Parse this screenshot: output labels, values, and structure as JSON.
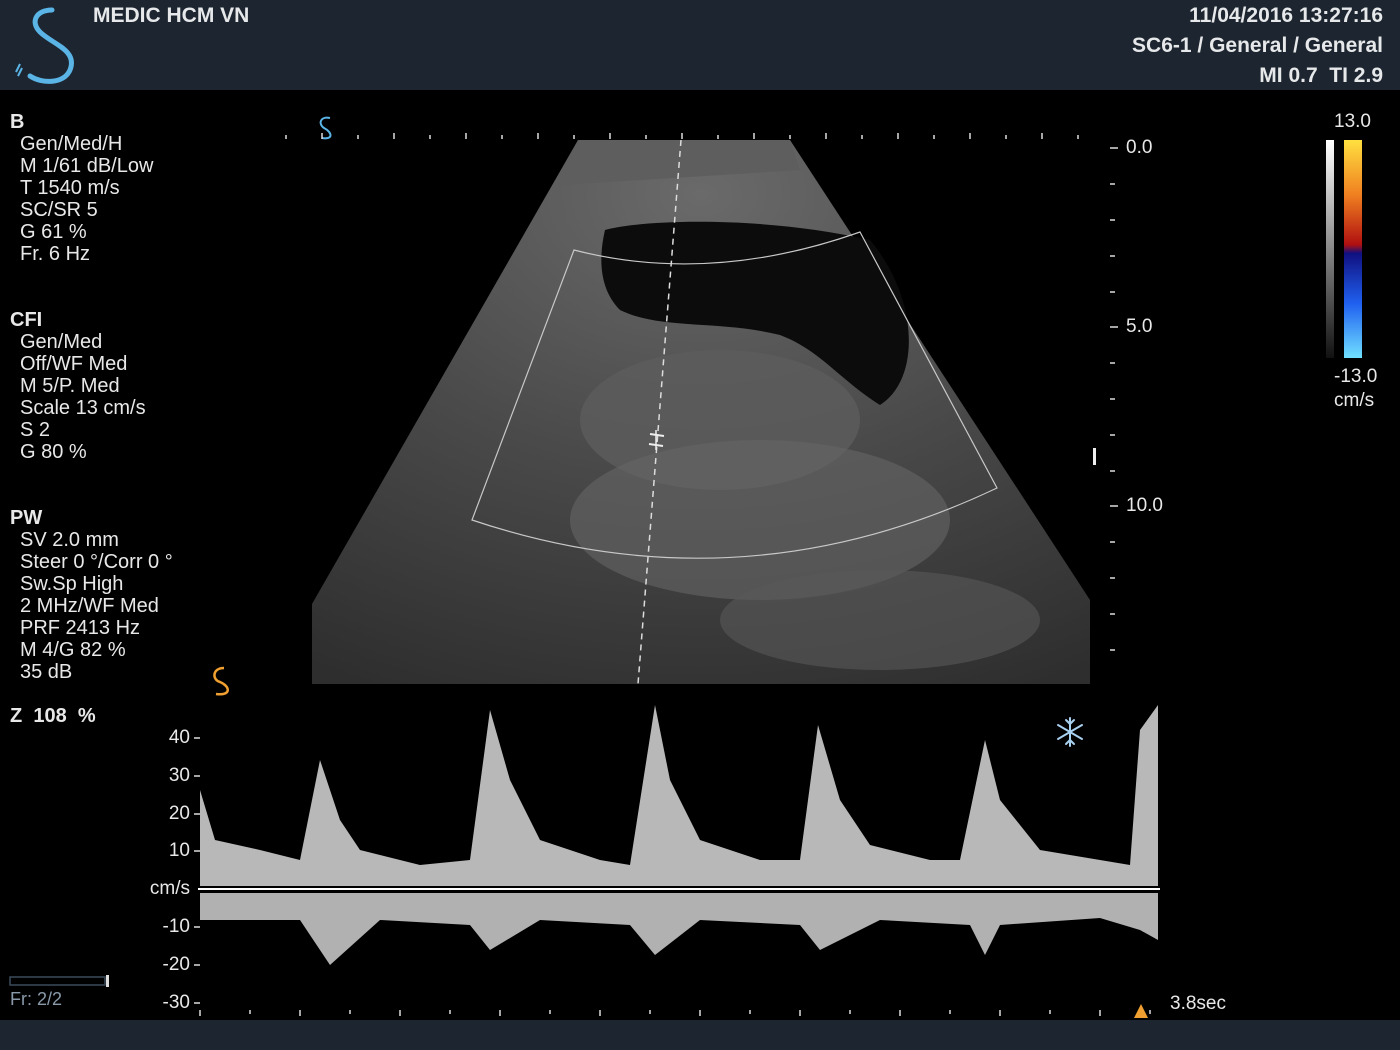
{
  "header": {
    "hospital": "MEDIC HCM VN",
    "datetime": "11/04/2016 13:27:16",
    "probe_preset": "SC6-1 / General / General",
    "mi_ti": "MI 0.7  TI 2.9"
  },
  "params": {
    "b": {
      "title": "B",
      "lines": [
        "Gen/Med/H",
        "M 1/61 dB/Low",
        "T 1540 m/s",
        "SC/SR 5",
        "G 61 %",
        "Fr. 6 Hz"
      ]
    },
    "cfi": {
      "title": "CFI",
      "lines": [
        "Gen/Med",
        "Off/WF Med",
        "M 5/P. Med",
        "Scale 13 cm/s",
        "S 2",
        "G 80 %"
      ]
    },
    "pw": {
      "title": "PW",
      "lines": [
        "SV 2.0 mm",
        "Steer 0 °/Corr 0 °",
        "Sw.Sp High",
        "2 MHz/WF Med",
        "PRF 2413 Hz",
        "M 4/G 82 %",
        "35 dB"
      ]
    },
    "zoom": "Z  108  %"
  },
  "depth_scale": {
    "labels": [
      "0.0",
      "5.0",
      "10.0"
    ]
  },
  "color_bar": {
    "max": "13.0",
    "min": "-13.0",
    "unit": "cm/s"
  },
  "spectral": {
    "velocity_labels": [
      "40",
      "30",
      "20",
      "10",
      "cm/s",
      "-10",
      "-20",
      "-30"
    ],
    "sweep_time": "3.8sec",
    "frame_counter": "Fr: 2/2",
    "frozen_icon": "snowflake-icon"
  },
  "colors": {
    "header_bg": "#1d2630",
    "brand_blue": "#5ab4e6",
    "brand_orange": "#f0a030"
  }
}
